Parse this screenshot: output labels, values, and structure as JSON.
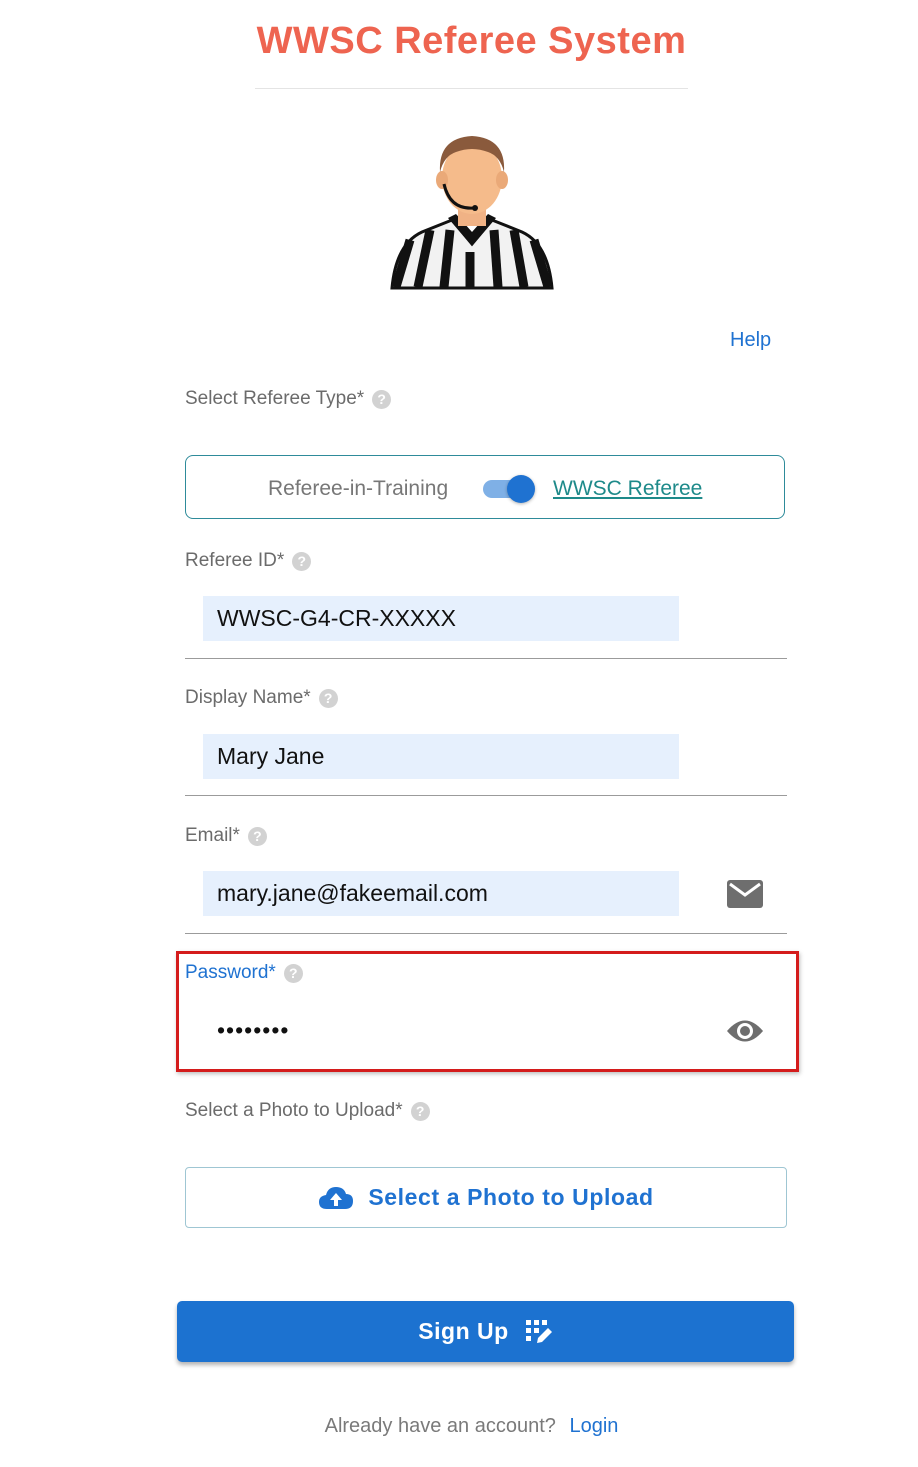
{
  "colors": {
    "brand": "#ee6450",
    "link": "#1f72d1",
    "primary_button": "#1c72d0",
    "toggle_active": "#1f72d1",
    "highlight": "#d41c1c"
  },
  "header": {
    "title": "WWSC Referee System"
  },
  "help_link": "Help",
  "referee_type": {
    "label": "Select Referee Type*",
    "option_left": "Referee-in-Training",
    "option_right": "WWSC Referee",
    "selected": "WWSC Referee"
  },
  "fields": {
    "referee_id": {
      "label": "Referee ID*",
      "value": "WWSC-G4-CR-XXXXX"
    },
    "display_name": {
      "label": "Display Name*",
      "value": "Mary Jane"
    },
    "email": {
      "label": "Email*",
      "value": "mary.jane@fakeemail.com"
    },
    "password": {
      "label": "Password*",
      "value": "••••••••"
    }
  },
  "photo": {
    "label": "Select a Photo to Upload*",
    "button_label": "Select a Photo to Upload"
  },
  "signup": {
    "button_label": "Sign Up"
  },
  "footer": {
    "prompt": "Already have an account?",
    "login_link": "Login"
  },
  "icons": {
    "help": "question-circle-icon",
    "email": "envelope-icon",
    "password": "eye-icon",
    "upload": "cloud-upload-icon",
    "signup": "grid-pencil-icon"
  }
}
